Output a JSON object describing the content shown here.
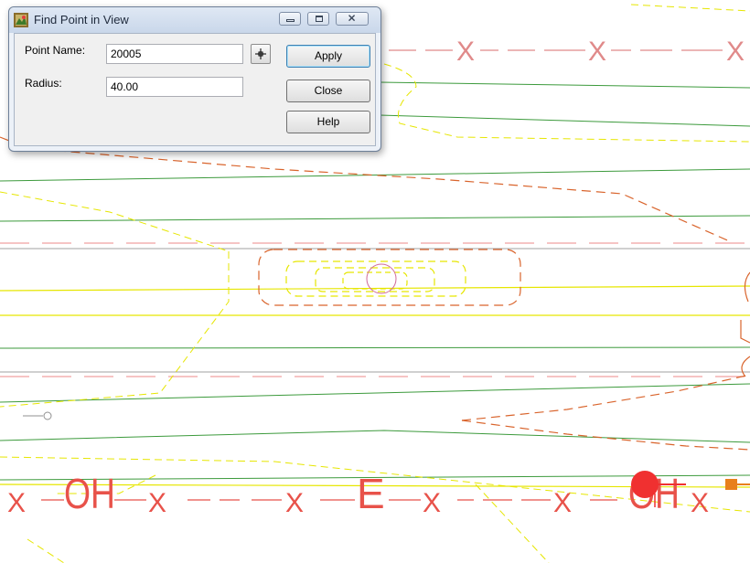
{
  "dialog": {
    "title": "Find Point in View",
    "point_name_label": "Point Name:",
    "point_name_value": "20005",
    "radius_label": "Radius:",
    "radius_value": "40.00",
    "apply_label": "Apply",
    "close_label": "Close",
    "help_label": "Help"
  },
  "drawing": {
    "fence_marker": "X",
    "overhead_label": "OH",
    "electric_label": "E",
    "colors": {
      "fence": "#e08a8a",
      "line_red": "#e8524a",
      "yellow": "#e6e600",
      "green": "#3c9a3c",
      "gray": "#a0a0a0",
      "orange_dash": "#d9642c",
      "red_point": "#f03030"
    }
  },
  "icons": {
    "app": "app-icon",
    "minimize": "minimize-icon",
    "maximize": "maximize-icon",
    "close": "close-icon",
    "pick_point": "crosshair-icon"
  }
}
